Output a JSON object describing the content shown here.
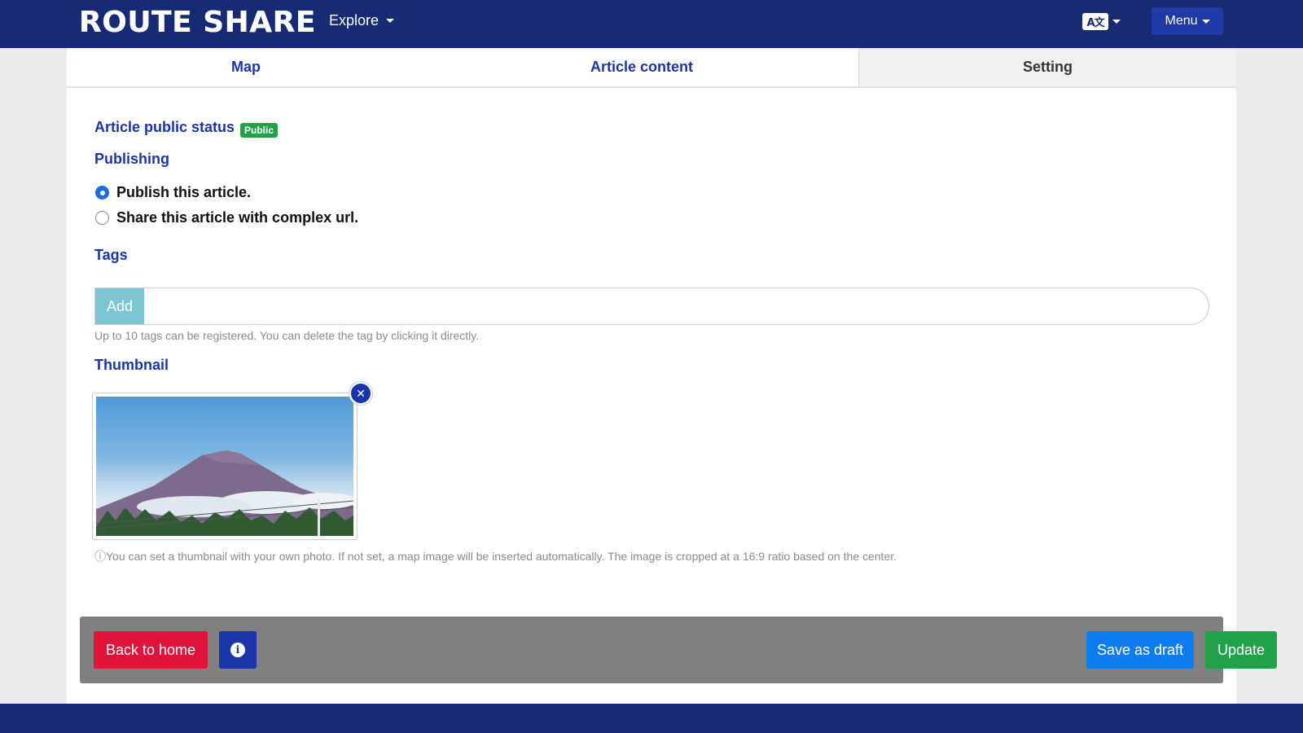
{
  "header": {
    "logo": "ROUTE SHARE",
    "explore_label": "Explore",
    "language_icon": "translate-icon",
    "menu_label": "Menu"
  },
  "tabs": [
    {
      "label": "Map"
    },
    {
      "label": "Article content"
    },
    {
      "label": "Setting",
      "active": true
    }
  ],
  "status": {
    "label": "Article public status",
    "badge": "Public",
    "badge_color": "#21a24a"
  },
  "publishing": {
    "label": "Publishing",
    "options": [
      {
        "label": "Publish this article.",
        "checked": true
      },
      {
        "label": "Share this article with complex url.",
        "checked": false
      }
    ]
  },
  "tags": {
    "label": "Tags",
    "add_button": "Add",
    "input_value": "",
    "help": "Up to 10 tags can be registered. You can delete the tag by clicking it directly."
  },
  "thumbnail": {
    "label": "Thumbnail",
    "remove_icon": "close-icon",
    "help": "ⓘYou can set a thumbnail with your own photo. If not set, a map image will be inserted automatically. The image is cropped at a 16:9 ratio based on the center."
  },
  "footer": {
    "back_home": "Back to home",
    "info_icon": "info-icon",
    "save_draft": "Save as draft",
    "update": "Update"
  },
  "colors": {
    "navy": "#172b74",
    "primary_blue": "#1a35a8",
    "danger_red": "#e0133a",
    "success_green": "#21a24a",
    "draft_blue": "#0d7cf0"
  }
}
